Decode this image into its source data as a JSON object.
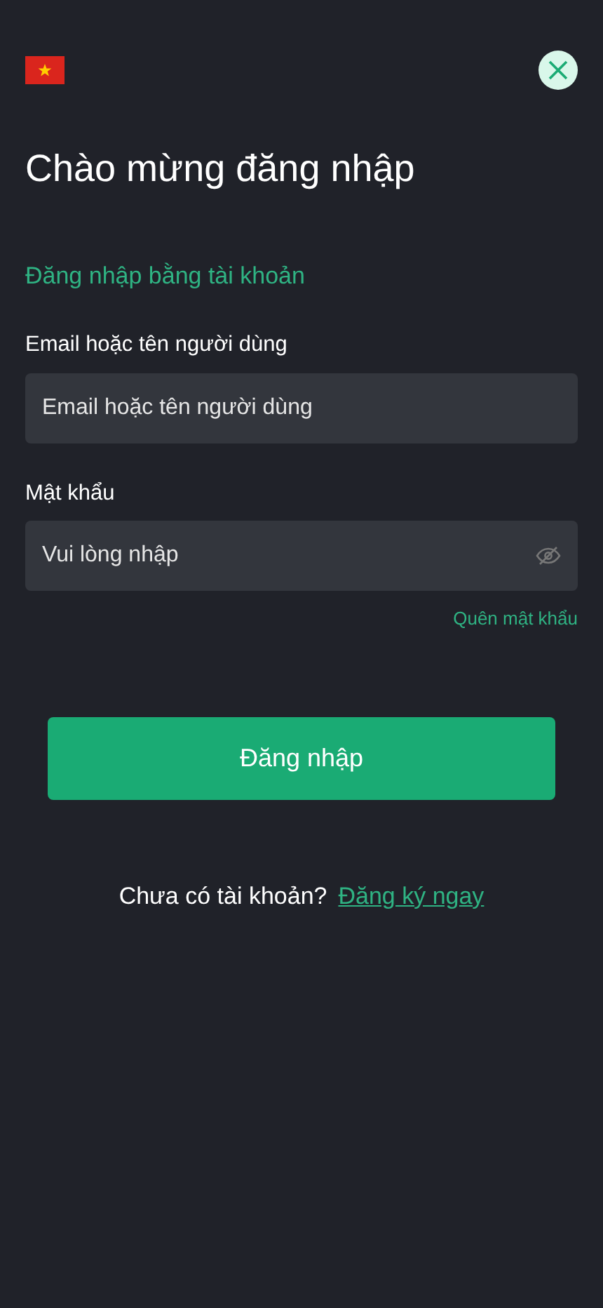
{
  "title": "Chào mừng đăng nhập",
  "login_method": "Đăng nhập bằng tài khoản",
  "fields": [
    {
      "label": "Email hoặc tên người dùng",
      "placeholder": "Email hoặc tên người dùng",
      "kind": "text"
    },
    {
      "label": "Mật khẩu",
      "placeholder": "Vui lòng nhập",
      "kind": "password"
    }
  ],
  "forgot_password": "Quên mật khẩu",
  "submit": "Đăng nhập",
  "signup_prompt": "Chưa có tài khoản?",
  "signup_link": "Đăng ký ngay"
}
